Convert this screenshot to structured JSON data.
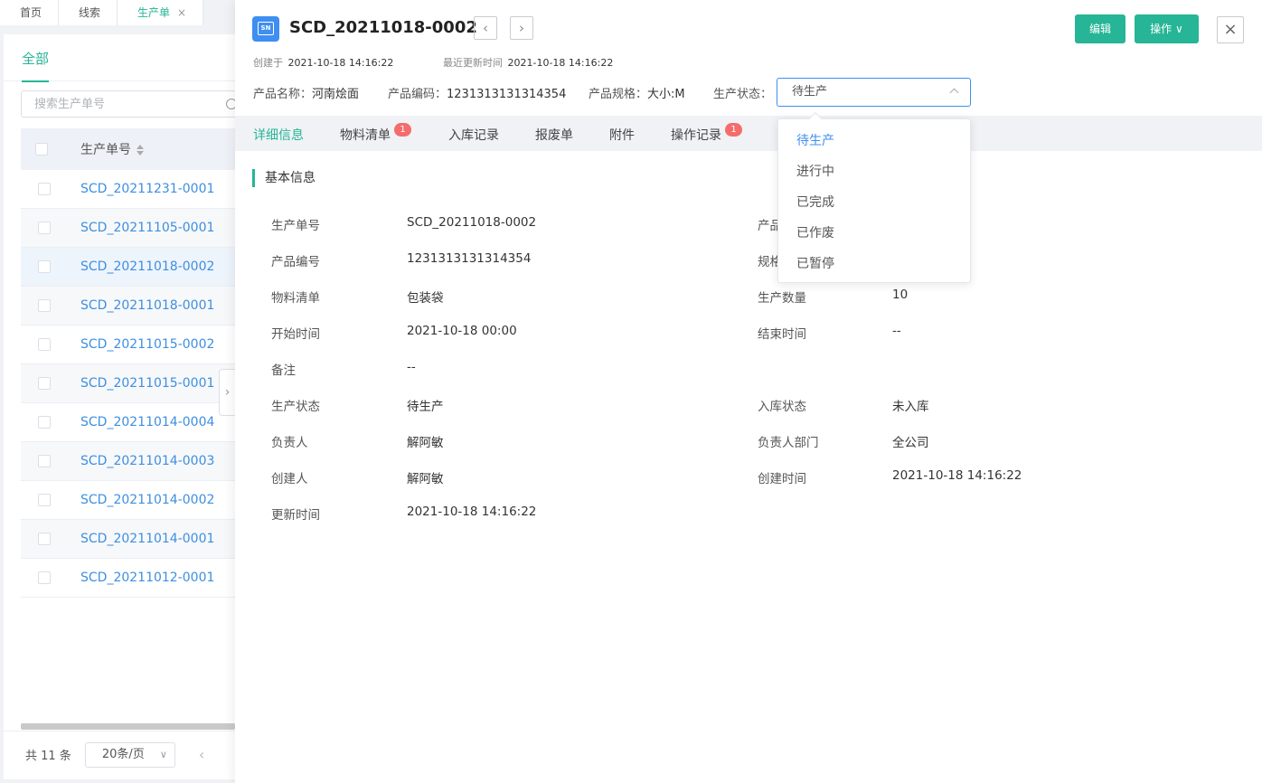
{
  "top_tabs": [
    {
      "label": "首页"
    },
    {
      "label": "线索"
    },
    {
      "label": "生产单",
      "active": true
    }
  ],
  "list_panel": {
    "filter_tab": "全部",
    "search_placeholder": "搜索生产单号",
    "column_header": "生产单号",
    "rows": [
      "SCD_20211231-0001",
      "SCD_20211105-0001",
      "SCD_20211018-0002",
      "SCD_20211018-0001",
      "SCD_20211015-0002",
      "SCD_20211015-0001",
      "SCD_20211014-0004",
      "SCD_20211014-0003",
      "SCD_20211014-0002",
      "SCD_20211014-0001",
      "SCD_20211012-0001"
    ],
    "selected_row": "SCD_20211018-0002",
    "total": "共 11 条",
    "page_size": "20条/页"
  },
  "detail": {
    "icon_text": "SN",
    "title": "SCD_20211018-0002",
    "edit_label": "编辑",
    "ops_label": "操作",
    "created_label": "创建于",
    "created_value": "2021-10-18 14:16:22",
    "updated_label": "最近更新时间",
    "updated_value": "2021-10-18 14:16:22",
    "product_name_label": "产品名称：",
    "product_name": "河南烩面",
    "product_code_label": "产品编码：",
    "product_code": "1231313131314354",
    "product_spec_label": "产品规格：",
    "product_spec": "大小:M",
    "status_label": "生产状态：",
    "status_value": "待生产",
    "tabs": [
      {
        "label": "详细信息",
        "active": true
      },
      {
        "label": "物料清单",
        "badge": "1"
      },
      {
        "label": "入库记录"
      },
      {
        "label": "报废单"
      },
      {
        "label": "附件"
      },
      {
        "label": "操作记录",
        "badge": "1"
      }
    ],
    "section_title": "基本信息",
    "fields_left": [
      {
        "label": "生产单号",
        "value": "SCD_20211018-0002"
      },
      {
        "label": "产品编号",
        "value": "1231313131314354"
      },
      {
        "label": "物料清单",
        "value": "包装袋"
      },
      {
        "label": "开始时间",
        "value": "2021-10-18 00:00"
      },
      {
        "label": "备注",
        "value": "--"
      },
      {
        "label": "生产状态",
        "value": "待生产"
      },
      {
        "label": "负责人",
        "value": "解阿敏"
      },
      {
        "label": "创建人",
        "value": "解阿敏"
      },
      {
        "label": "更新时间",
        "value": "2021-10-18 14:16:22"
      }
    ],
    "fields_right": [
      {
        "label": "产品",
        "value": ""
      },
      {
        "label": "规格",
        "value": ""
      },
      {
        "label": "生产数量",
        "value": "10"
      },
      {
        "label": "结束时间",
        "value": "--"
      },
      {
        "label": "入库状态",
        "value": "未入库"
      },
      {
        "label": "负责人部门",
        "value": "全公司"
      },
      {
        "label": "创建时间",
        "value": "2021-10-18 14:16:22"
      }
    ]
  },
  "status_dropdown": {
    "options": [
      "待生产",
      "进行中",
      "已完成",
      "已作废",
      "已暂停"
    ],
    "selected": "待生产"
  },
  "colors": {
    "accent": "#26b596",
    "link": "#3d8fe0",
    "select_border": "#3e8ff1",
    "badge": "#f56c6c"
  }
}
